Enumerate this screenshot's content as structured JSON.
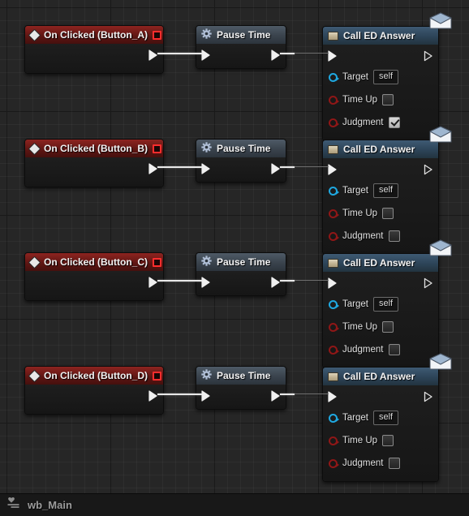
{
  "statusbar": {
    "icon": "widget-blueprint-icon",
    "label": "wb_Main"
  },
  "graph": {
    "background_color": "#262626",
    "grid_color": "#2f2f2f",
    "wire_color": "#e8e8e8"
  },
  "rows": [
    {
      "event": {
        "title": "On Clicked (Button_A)",
        "icon": "event-diamond-icon",
        "delegate_pin": "delegate-pin",
        "header_color": "#8e2420"
      },
      "pause": {
        "title": "Pause Time",
        "icon": "gear-icon",
        "header_color": "#4e5a66"
      },
      "call": {
        "title": "Call ED Answer",
        "icon": "function-icon",
        "badge_icon": "envelope-icon",
        "header_color": "#3e5a73",
        "pins": [
          {
            "label": "Target",
            "type": "object",
            "value": "self"
          },
          {
            "label": "Time Up",
            "type": "bool",
            "checked": false
          },
          {
            "label": "Judgment",
            "type": "bool",
            "checked": true
          }
        ]
      }
    },
    {
      "event": {
        "title": "On Clicked (Button_B)",
        "icon": "event-diamond-icon",
        "delegate_pin": "delegate-pin",
        "header_color": "#8e2420"
      },
      "pause": {
        "title": "Pause Time",
        "icon": "gear-icon",
        "header_color": "#4e5a66"
      },
      "call": {
        "title": "Call ED Answer",
        "icon": "function-icon",
        "badge_icon": "envelope-icon",
        "header_color": "#3e5a73",
        "pins": [
          {
            "label": "Target",
            "type": "object",
            "value": "self"
          },
          {
            "label": "Time Up",
            "type": "bool",
            "checked": false
          },
          {
            "label": "Judgment",
            "type": "bool",
            "checked": false
          }
        ]
      }
    },
    {
      "event": {
        "title": "On Clicked (Button_C)",
        "icon": "event-diamond-icon",
        "delegate_pin": "delegate-pin",
        "header_color": "#8e2420"
      },
      "pause": {
        "title": "Pause Time",
        "icon": "gear-icon",
        "header_color": "#4e5a66"
      },
      "call": {
        "title": "Call ED Answer",
        "icon": "function-icon",
        "badge_icon": "envelope-icon",
        "header_color": "#3e5a73",
        "pins": [
          {
            "label": "Target",
            "type": "object",
            "value": "self"
          },
          {
            "label": "Time Up",
            "type": "bool",
            "checked": false
          },
          {
            "label": "Judgment",
            "type": "bool",
            "checked": false
          }
        ]
      }
    },
    {
      "event": {
        "title": "On Clicked (Button_D)",
        "icon": "event-diamond-icon",
        "delegate_pin": "delegate-pin",
        "header_color": "#8e2420"
      },
      "pause": {
        "title": "Pause Time",
        "icon": "gear-icon",
        "header_color": "#4e5a66"
      },
      "call": {
        "title": "Call ED Answer",
        "icon": "function-icon",
        "badge_icon": "envelope-icon",
        "header_color": "#3e5a73",
        "pins": [
          {
            "label": "Target",
            "type": "object",
            "value": "self"
          },
          {
            "label": "Time Up",
            "type": "bool",
            "checked": false
          },
          {
            "label": "Judgment",
            "type": "bool",
            "checked": false
          }
        ]
      }
    }
  ]
}
